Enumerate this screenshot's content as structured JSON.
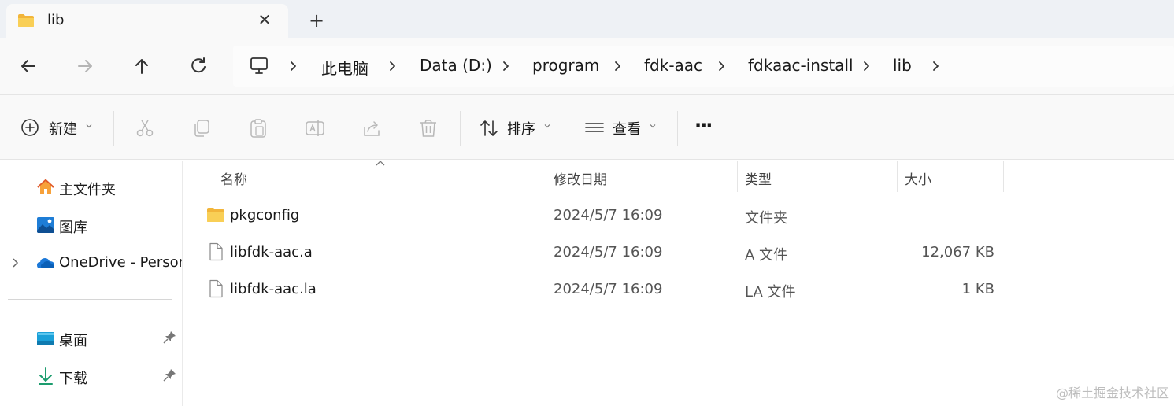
{
  "tab": {
    "title": "lib",
    "close_glyph": "✕",
    "new_tab_glyph": "+"
  },
  "nav": {
    "back_icon": "arrow-left-icon",
    "forward_icon": "arrow-right-icon",
    "up_icon": "arrow-up-icon",
    "refresh_icon": "refresh-icon"
  },
  "breadcrumb": {
    "items": [
      "此电脑",
      "Data (D:)",
      "program",
      "fdk-aac",
      "fdkaac-install",
      "lib"
    ]
  },
  "commands": {
    "new_label": "新建",
    "sort_label": "排序",
    "view_label": "查看",
    "more_label": "···"
  },
  "sidebar": {
    "items": [
      {
        "label": "主文件夹",
        "icon": "home-icon"
      },
      {
        "label": "图库",
        "icon": "gallery-icon"
      },
      {
        "label": "OneDrive - Persor",
        "icon": "onedrive-cloud-icon"
      },
      {
        "label": "桌面",
        "icon": "desktop-icon"
      },
      {
        "label": "下载",
        "icon": "download-icon"
      }
    ]
  },
  "columns": {
    "name": "名称",
    "date": "修改日期",
    "type": "类型",
    "size": "大小"
  },
  "files": [
    {
      "name": "pkgconfig",
      "date": "2024/5/7 16:09",
      "type": "文件夹",
      "size": "",
      "icon": "folder-icon"
    },
    {
      "name": "libfdk-aac.a",
      "date": "2024/5/7 16:09",
      "type": "A 文件",
      "size": "12,067 KB",
      "icon": "file-icon"
    },
    {
      "name": "libfdk-aac.la",
      "date": "2024/5/7 16:09",
      "type": "LA 文件",
      "size": "1 KB",
      "icon": "file-icon"
    }
  ],
  "watermark": "@稀土掘金技术社区",
  "colors": {
    "folder": "#F7C544",
    "accent": "#0067C0",
    "tabbar_bg": "#EEF1F5",
    "toolbar_bg": "#F9F9F9"
  }
}
